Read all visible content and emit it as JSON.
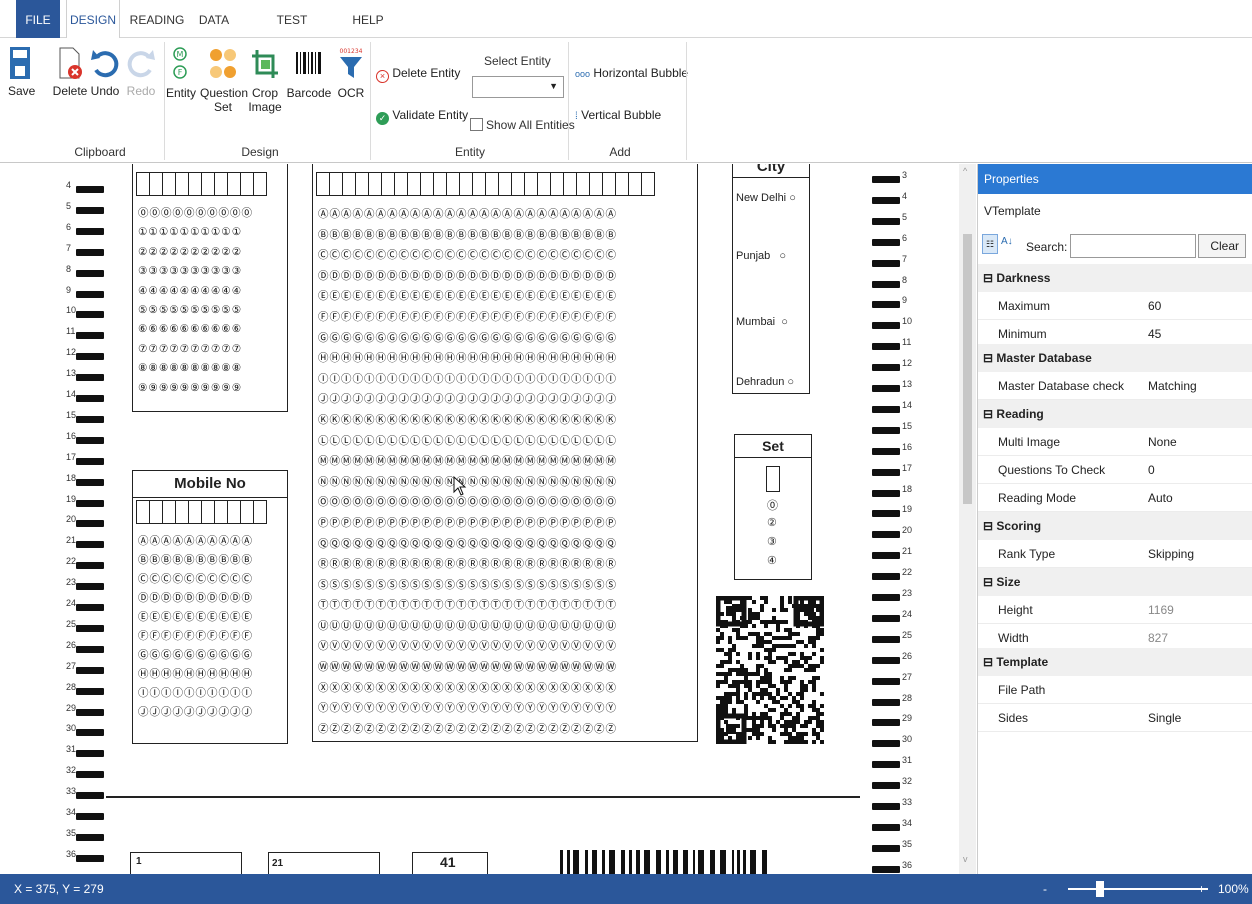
{
  "menu": {
    "tabs": [
      "FILE",
      "DESIGN",
      "READING",
      "DATA",
      "TEST ANALYTICS",
      "HELP"
    ]
  },
  "ribbon": {
    "clipboard": {
      "save": "Save",
      "delete": "Delete",
      "undo": "Undo",
      "redo": "Redo",
      "group": "Clipboard"
    },
    "design": {
      "entity": "Entity",
      "question_set_1": "Question",
      "question_set_2": "Set",
      "crop_1": "Crop",
      "crop_2": "Image",
      "barcode": "Barcode",
      "ocr": "OCR",
      "group": "Design"
    },
    "entity": {
      "delete_entity": "Delete Entity",
      "validate_entity": "Validate Entity",
      "select_entity_label": "Select Entity",
      "select_entity_value": "",
      "show_all": "Show All Entities",
      "group": "Entity"
    },
    "add": {
      "horizontal_bubble": "Horizontal Bubble",
      "vertical_bubble": "Vertical Bubble",
      "group": "Add"
    }
  },
  "canvas": {
    "mobile_no_label": "Mobile No",
    "city_label": "City",
    "cities": [
      "New Delhi",
      "Punjab",
      "Mumbai",
      "Dehradun"
    ],
    "set_label": "Set",
    "set_options": [
      "1",
      "2",
      "3",
      "4"
    ],
    "track_numbers_left": [
      "4",
      "5",
      "6",
      "7",
      "8",
      "9",
      "10",
      "11",
      "12",
      "13",
      "14",
      "15",
      "16",
      "17",
      "18",
      "19",
      "20",
      "21",
      "22",
      "23",
      "24",
      "25",
      "26",
      "27",
      "28",
      "29",
      "30",
      "31",
      "32",
      "33",
      "34",
      "35",
      "36"
    ],
    "track_numbers_right": [
      "3",
      "4",
      "5",
      "6",
      "7",
      "8",
      "9",
      "10",
      "11",
      "12",
      "13",
      "14",
      "15",
      "16",
      "17",
      "18",
      "19",
      "20",
      "21",
      "22",
      "23",
      "24",
      "25",
      "26",
      "27",
      "28",
      "29",
      "30",
      "31",
      "32",
      "33",
      "34",
      "35",
      "36"
    ],
    "bottom_box_labels": [
      "1",
      "21",
      "41"
    ],
    "digit_rows": [
      "0",
      "1",
      "2",
      "3",
      "4",
      "5",
      "6",
      "7",
      "8",
      "9"
    ],
    "letter_rows": [
      "A",
      "B",
      "C",
      "D",
      "E",
      "F",
      "G",
      "H",
      "I",
      "J",
      "K",
      "L",
      "M",
      "N",
      "O",
      "P",
      "Q",
      "R",
      "S",
      "T",
      "U",
      "V",
      "W",
      "X",
      "Y",
      "Z"
    ]
  },
  "properties": {
    "title": "Properties",
    "object": "VTemplate",
    "search_label": "Search:",
    "search_value": "",
    "clear": "Clear",
    "categories": {
      "darkness": "Darkness",
      "master_db": "Master Database",
      "reading": "Reading",
      "scoring": "Scoring",
      "size": "Size",
      "template": "Template"
    },
    "rows": {
      "maximum": {
        "k": "Maximum",
        "v": "60"
      },
      "minimum": {
        "k": "Minimum",
        "v": "45"
      },
      "master_db_check": {
        "k": "Master Database check",
        "v": "Matching"
      },
      "multi_image": {
        "k": "Multi Image",
        "v": "None"
      },
      "questions_to_check": {
        "k": "Questions To Check",
        "v": "0"
      },
      "reading_mode": {
        "k": "Reading Mode",
        "v": "Auto"
      },
      "rank_type": {
        "k": "Rank Type",
        "v": "Skipping"
      },
      "height": {
        "k": "Height",
        "v": "1169"
      },
      "width": {
        "k": "Width",
        "v": "827"
      },
      "file_path": {
        "k": "File Path",
        "v": ""
      },
      "sides": {
        "k": "Sides",
        "v": "Single"
      }
    }
  },
  "status": {
    "coords": "X = 375, Y = 279",
    "zoom_minus": "-",
    "zoom_plus": "+",
    "zoom": "100%"
  },
  "colors": {
    "accent": "#2b579a",
    "props_header": "#2b79d3"
  }
}
